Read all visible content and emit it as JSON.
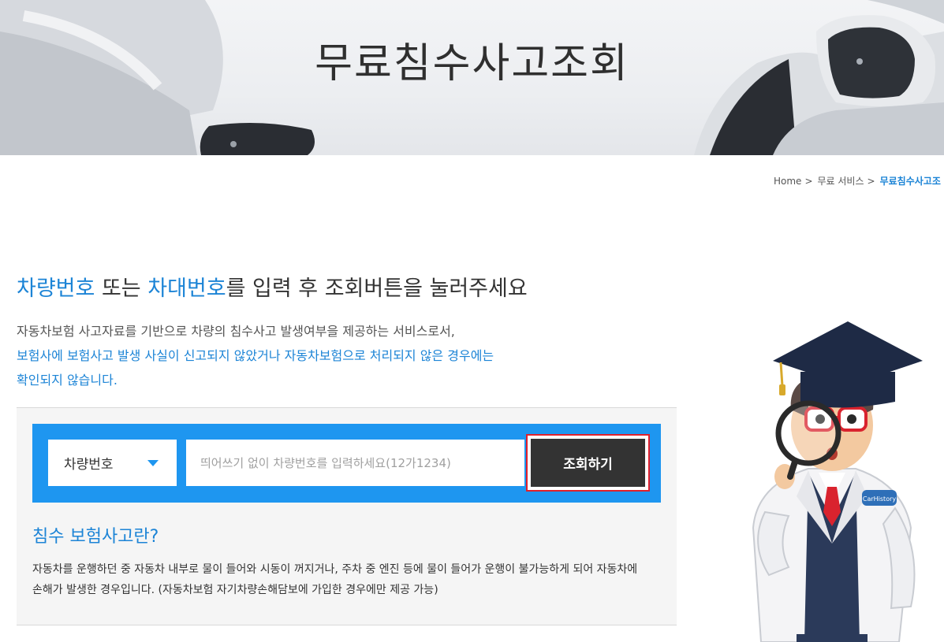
{
  "hero": {
    "title": "무료침수사고조회"
  },
  "breadcrumb": {
    "items": [
      "Home",
      "무료 서비스",
      "무료침수사고조"
    ],
    "separator": ">"
  },
  "headline": {
    "part1": "차량번호",
    "part2": " 또는 ",
    "part3": "차대번호",
    "part4": "를 입력 후 조회버튼을 눌러주세요"
  },
  "description": {
    "line1": "자동차보험 사고자료를 기반으로 차량의 침수사고 발생여부을 제공하는 서비스로서,",
    "line2": "보험사에 보험사고 발생 사실이 신고되지 않았거나 자동차보험으로 처리되지 않은 경우에는",
    "line3": "확인되지 않습니다."
  },
  "search": {
    "select_value": "차량번호",
    "placeholder": "띄어쓰기 없이 차량번호를 입력하세요(12가1234)",
    "button_label": "조회하기"
  },
  "info": {
    "title": "침수 보험사고란?",
    "line1": "자동차를 운행하던 중 자동차 내부로 물이 들어와 시동이 꺼지거나, 주차 중 엔진 등에 물이 들어가 운행이 불가능하게 되어 자동차에",
    "line2": "손해가 발생한 경우입니다. (자동차보험 자기차량손해담보에 가입한 경우에만 제공 가능)"
  },
  "mascot": {
    "badge_text": "CarHistory"
  },
  "colors": {
    "accent": "#1c84d6",
    "bar": "#1e96f0",
    "button": "#333333",
    "highlight": "#e0202b"
  }
}
